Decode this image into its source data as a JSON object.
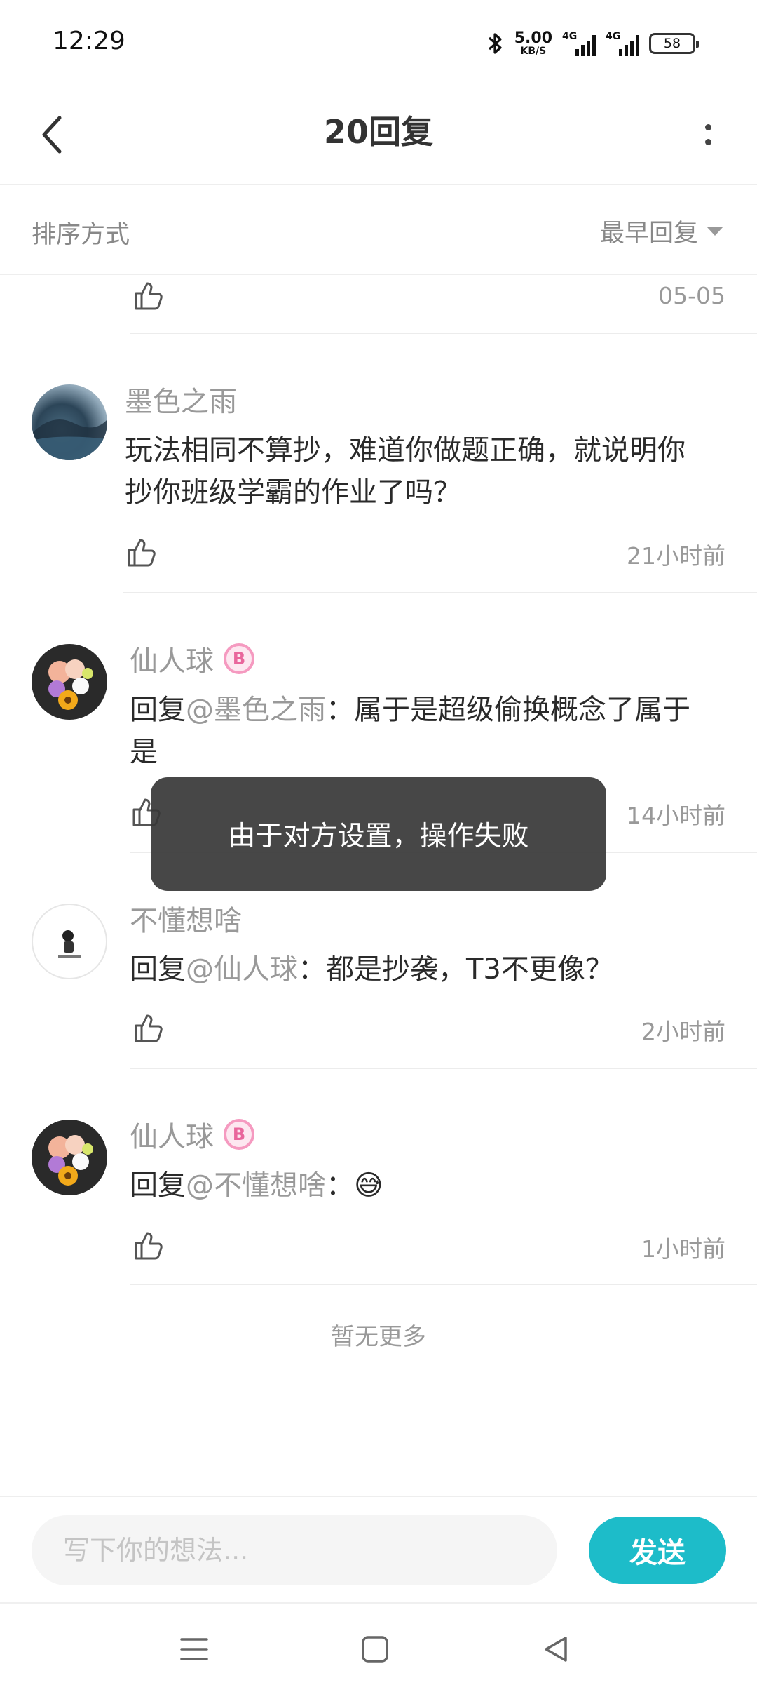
{
  "status_bar": {
    "time": "12:29",
    "net_speed_value": "5.00",
    "net_speed_unit": "KB/S",
    "sim1": "4G",
    "sim2": "4G",
    "battery": "58"
  },
  "header": {
    "title": "20回复",
    "back_icon": "chevron-left-icon",
    "more_icon": "more-vertical-icon"
  },
  "sort": {
    "label": "排序方式",
    "selected": "最早回复"
  },
  "partial_row": {
    "time": "05-05"
  },
  "comments": [
    {
      "user": "墨色之雨",
      "badge": "",
      "mention": "",
      "prefix": "",
      "text_line1": "玩法相同不算抄，难道你做题正确，就说明你",
      "text_line2": "抄你班级学霸的作业了吗？",
      "time": "21小时前"
    },
    {
      "user": "仙人球",
      "badge": "B",
      "prefix": "回复",
      "mention": "@墨色之雨",
      "text_line1": "：属于是超级偷换概念了属于",
      "text_line2": "是",
      "time": "14小时前"
    },
    {
      "user": "不懂想啥",
      "badge": "",
      "prefix": "回复",
      "mention": "@仙人球",
      "text_line1": "：都是抄袭，T3不更像？",
      "text_line2": "",
      "time": "2小时前"
    },
    {
      "user": "仙人球",
      "badge": "B",
      "prefix": "回复",
      "mention": "@不懂想啥",
      "text_line1": "：😅",
      "text_line2": "",
      "time": "1小时前"
    }
  ],
  "toast": "由于对方设置，操作失败",
  "no_more": "暂无更多",
  "input": {
    "placeholder": "写下你的想法...",
    "value": "",
    "send_label": "发送"
  },
  "colors": {
    "accent": "#1dbcc9",
    "badge_pink": "#f59ac0",
    "muted_text": "#999999"
  }
}
